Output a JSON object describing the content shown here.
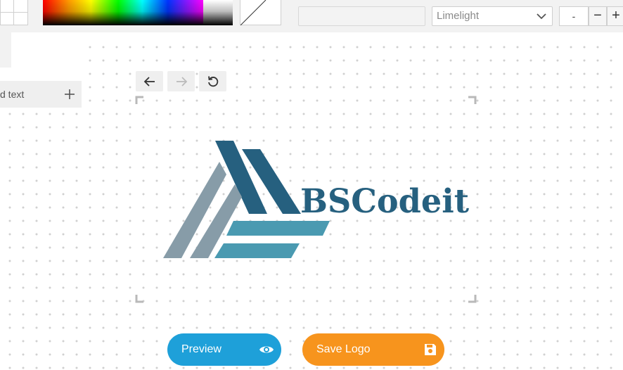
{
  "toolbar": {
    "font_select": {
      "value": "Limelight"
    },
    "size_field": {
      "value": "-"
    },
    "minus_label": "−",
    "plus_label": "+"
  },
  "panel": {
    "add_text_label": "d text"
  },
  "logo": {
    "text": "BSCodeit",
    "colors": {
      "dark": "#26607f",
      "slate": "#879ca8",
      "teal": "#4a9ab1"
    }
  },
  "buttons": {
    "preview_label": "Preview",
    "save_label": "Save Logo"
  },
  "colors": {
    "preview": "#1ea0d9",
    "save": "#f7941d",
    "toolbar_bg": "#f2f2f2"
  },
  "icons": [
    "arrow-left-icon",
    "arrow-right-icon",
    "reset-icon",
    "chevron-down-icon",
    "plus-icon",
    "eye-icon",
    "floppy-disk-icon"
  ]
}
